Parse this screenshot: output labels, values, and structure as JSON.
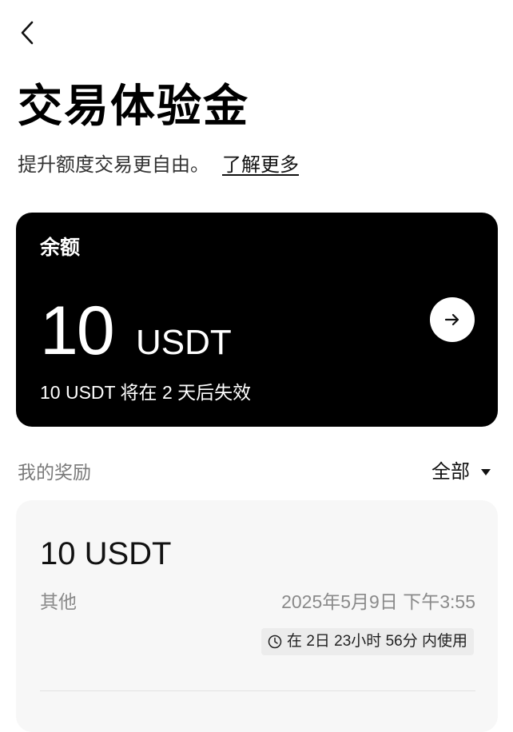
{
  "nav": {
    "back_icon": "chevron-left-icon"
  },
  "header": {
    "title": "交易体验金",
    "subtitle": "提升额度交易更自由。",
    "learn_more": "了解更多"
  },
  "balance": {
    "label": "余额",
    "amount": "10",
    "unit": "USDT",
    "expire_note": "10 USDT 将在 2 天后失效",
    "arrow_icon": "arrow-right-icon"
  },
  "rewards": {
    "section_label": "我的奖励",
    "filter_label": "全部",
    "filter_icon": "caret-down-icon",
    "items": [
      {
        "amount": "10 USDT",
        "type": "其他",
        "date": "2025年5月9日 下午3:55",
        "usage": "在 2日 23小时 56分 内使用",
        "usage_icon": "clock-icon"
      }
    ]
  },
  "colors": {
    "card_dark": "#000000",
    "card_light": "#f7f7f7",
    "muted_text": "#8a8a8a",
    "chip_bg": "#ececec"
  }
}
